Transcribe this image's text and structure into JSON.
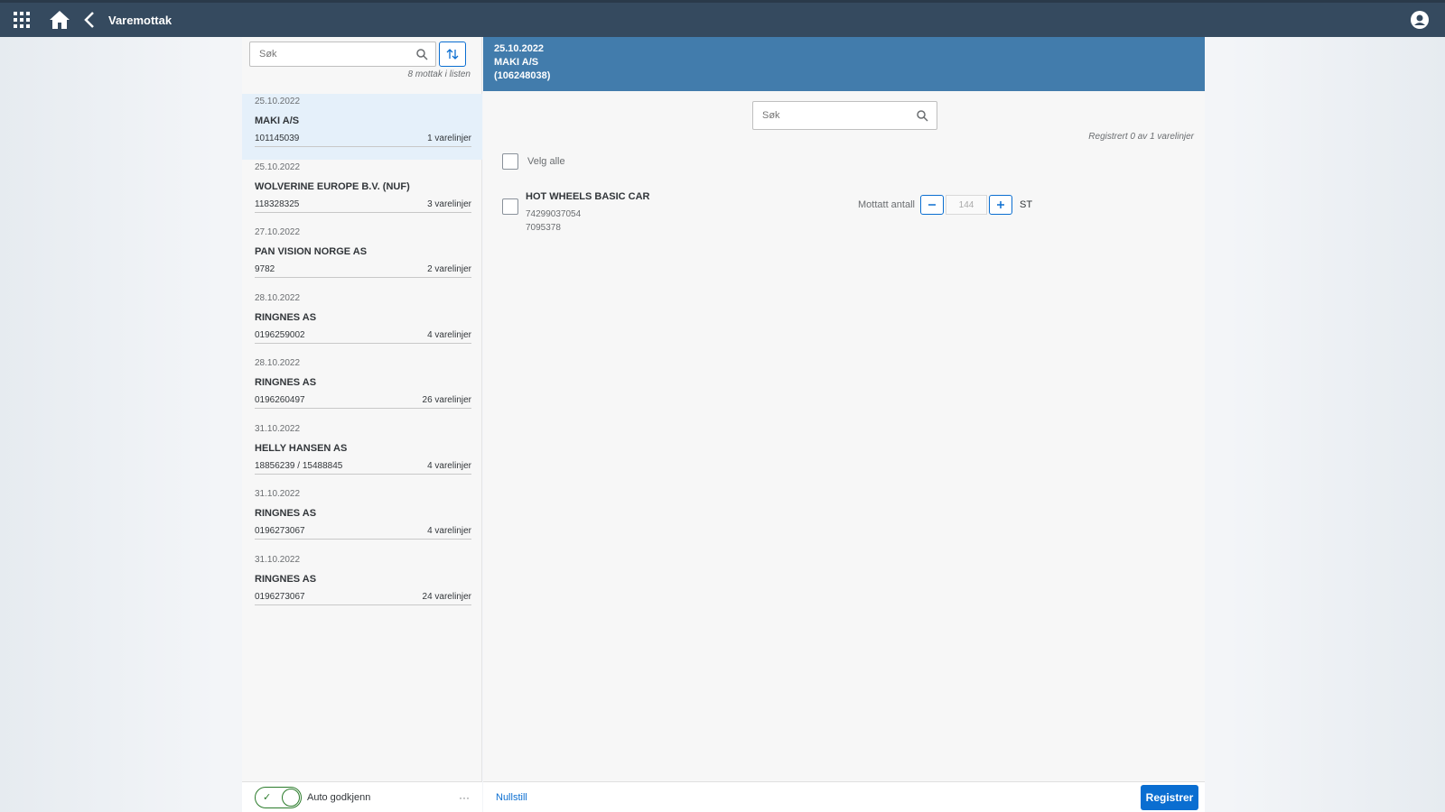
{
  "shell": {
    "title": "Varemottak",
    "icons": [
      "grid-icon",
      "home-icon",
      "back-icon",
      "user-icon"
    ]
  },
  "master": {
    "search_placeholder": "Søk",
    "count_text": "8 mottak i listen",
    "items": [
      {
        "date": "25.10.2022",
        "name": "MAKI A/S",
        "ref": "101145039",
        "lines": "1 varelinjer"
      },
      {
        "date": "25.10.2022",
        "name": "WOLVERINE EUROPE B.V. (NUF)",
        "ref": "118328325",
        "lines": "3 varelinjer"
      },
      {
        "date": "27.10.2022",
        "name": "PAN VISION NORGE AS",
        "ref": "9782",
        "lines": "2 varelinjer"
      },
      {
        "date": "28.10.2022",
        "name": "RINGNES AS",
        "ref": "0196259002",
        "lines": "4 varelinjer"
      },
      {
        "date": "28.10.2022",
        "name": "RINGNES AS",
        "ref": "0196260497",
        "lines": "26 varelinjer"
      },
      {
        "date": "31.10.2022",
        "name": "HELLY HANSEN AS",
        "ref": "18856239 / 15488845",
        "lines": "4 varelinjer"
      },
      {
        "date": "31.10.2022",
        "name": "RINGNES AS",
        "ref": "0196273067",
        "lines": "4 varelinjer"
      },
      {
        "date": "31.10.2022",
        "name": "RINGNES AS",
        "ref": "0196273067",
        "lines": "24 varelinjer"
      }
    ],
    "toggle_label": "Auto godkjenn",
    "more_label": "···"
  },
  "detail": {
    "header_date": "25.10.2022",
    "header_name": "MAKI A/S",
    "header_ref": "(106248038)",
    "search_placeholder": "Søk",
    "registered_text": "Registrert 0 av 1 varelinjer",
    "select_all_label": "Velg alle",
    "item": {
      "name": "HOT WHEELS BASIC CAR",
      "ean": "74299037054",
      "number": "7095378",
      "qty_label": "Mottatt antall",
      "qty_value": "144",
      "unit": "ST"
    },
    "footer_link": "Nullstill",
    "register_label": "Registrer"
  },
  "colors": {
    "shell": "#354a5f",
    "header": "#427cac",
    "accent": "#0a6ed1",
    "toggle": "#2b7c2b",
    "selected": "#e5f0fa"
  }
}
